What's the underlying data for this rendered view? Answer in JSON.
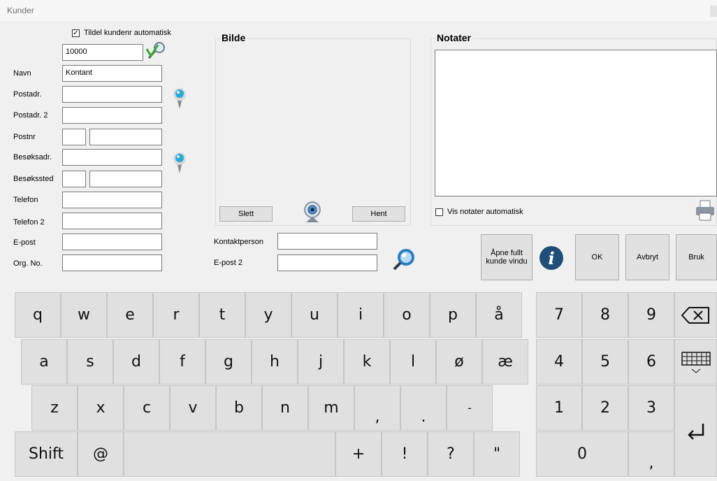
{
  "window": {
    "title": "Kunder"
  },
  "customer": {
    "auto_number_label": "Tildel kundenr automatisk",
    "auto_number_checked": true,
    "customer_number": "10000",
    "fields": [
      {
        "label": "Navn",
        "value": "Kontant"
      },
      {
        "label": "Postadr.",
        "value": ""
      },
      {
        "label": "Postadr. 2",
        "value": ""
      },
      {
        "label": "Postnr",
        "value": ""
      },
      {
        "label": "Besøksadr.",
        "value": ""
      },
      {
        "label": "Besøkssted",
        "value": ""
      },
      {
        "label": "Telefon",
        "value": ""
      },
      {
        "label": "Telefon 2",
        "value": ""
      },
      {
        "label": "E-post",
        "value": ""
      },
      {
        "label": "Org. No.",
        "value": ""
      }
    ]
  },
  "picture": {
    "title": "Bilde",
    "delete_label": "Slett",
    "fetch_label": "Hent"
  },
  "contact": {
    "person_label": "Kontaktperson",
    "email2_label": "E-post 2",
    "person_value": "",
    "email2_value": ""
  },
  "notes": {
    "title": "Notater",
    "show_auto_label": "Vis notater automatisk",
    "show_auto_checked": false,
    "text": ""
  },
  "actions": {
    "open_full_label": "Åpne fullt kunde vindu",
    "ok_label": "OK",
    "cancel_label": "Avbryt",
    "apply_label": "Bruk"
  },
  "keyboard": {
    "row1": [
      "q",
      "w",
      "e",
      "r",
      "t",
      "y",
      "u",
      "i",
      "o",
      "p",
      "å"
    ],
    "row2": [
      "a",
      "s",
      "d",
      "f",
      "g",
      "h",
      "j",
      "k",
      "l",
      "ø",
      "æ"
    ],
    "row3": [
      "z",
      "x",
      "c",
      "v",
      "b",
      "n",
      "m",
      ",",
      ".",
      "-"
    ],
    "shift": "Shift",
    "at": "@",
    "row4": [
      "+",
      "!",
      "?",
      "\""
    ],
    "numpad": [
      [
        "7",
        "8",
        "9"
      ],
      [
        "4",
        "5",
        "6"
      ],
      [
        "1",
        "2",
        "3"
      ]
    ],
    "zero": "0",
    "comma": ","
  },
  "colors": {
    "pin": "#29a9d8",
    "info": "#1f4e79"
  }
}
